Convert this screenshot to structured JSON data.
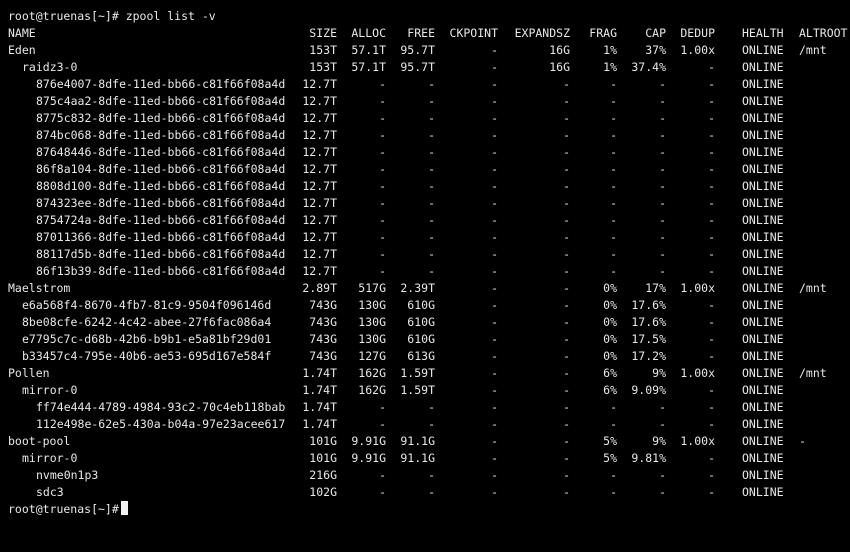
{
  "terminal": {
    "prompt_command": "root@truenas[~]# zpool list -v",
    "prompt_end": "root@truenas[~]#"
  },
  "headers": [
    "NAME",
    "SIZE",
    "ALLOC",
    "FREE",
    "CKPOINT",
    "EXPANDSZ",
    "FRAG",
    "CAP",
    "DEDUP",
    "HEALTH",
    "ALTROOT"
  ],
  "rows": [
    {
      "indent": 0,
      "cells": [
        "Eden",
        "153T",
        "57.1T",
        "95.7T",
        "-",
        "16G",
        "1%",
        "37%",
        "1.00x",
        "ONLINE",
        "/mnt"
      ]
    },
    {
      "indent": 1,
      "cells": [
        "raidz3-0",
        "153T",
        "57.1T",
        "95.7T",
        "-",
        "16G",
        "1%",
        "37.4%",
        "-",
        "ONLINE",
        ""
      ]
    },
    {
      "indent": 2,
      "cells": [
        "876e4007-8dfe-11ed-bb66-c81f66f08a4d",
        "12.7T",
        "-",
        "-",
        "-",
        "-",
        "-",
        "-",
        "-",
        "ONLINE",
        ""
      ]
    },
    {
      "indent": 2,
      "cells": [
        "875c4aa2-8dfe-11ed-bb66-c81f66f08a4d",
        "12.7T",
        "-",
        "-",
        "-",
        "-",
        "-",
        "-",
        "-",
        "ONLINE",
        ""
      ]
    },
    {
      "indent": 2,
      "cells": [
        "8775c832-8dfe-11ed-bb66-c81f66f08a4d",
        "12.7T",
        "-",
        "-",
        "-",
        "-",
        "-",
        "-",
        "-",
        "ONLINE",
        ""
      ]
    },
    {
      "indent": 2,
      "cells": [
        "874bc068-8dfe-11ed-bb66-c81f66f08a4d",
        "12.7T",
        "-",
        "-",
        "-",
        "-",
        "-",
        "-",
        "-",
        "ONLINE",
        ""
      ]
    },
    {
      "indent": 2,
      "cells": [
        "87648446-8dfe-11ed-bb66-c81f66f08a4d",
        "12.7T",
        "-",
        "-",
        "-",
        "-",
        "-",
        "-",
        "-",
        "ONLINE",
        ""
      ]
    },
    {
      "indent": 2,
      "cells": [
        "86f8a104-8dfe-11ed-bb66-c81f66f08a4d",
        "12.7T",
        "-",
        "-",
        "-",
        "-",
        "-",
        "-",
        "-",
        "ONLINE",
        ""
      ]
    },
    {
      "indent": 2,
      "cells": [
        "8808d100-8dfe-11ed-bb66-c81f66f08a4d",
        "12.7T",
        "-",
        "-",
        "-",
        "-",
        "-",
        "-",
        "-",
        "ONLINE",
        ""
      ]
    },
    {
      "indent": 2,
      "cells": [
        "874323ee-8dfe-11ed-bb66-c81f66f08a4d",
        "12.7T",
        "-",
        "-",
        "-",
        "-",
        "-",
        "-",
        "-",
        "ONLINE",
        ""
      ]
    },
    {
      "indent": 2,
      "cells": [
        "8754724a-8dfe-11ed-bb66-c81f66f08a4d",
        "12.7T",
        "-",
        "-",
        "-",
        "-",
        "-",
        "-",
        "-",
        "ONLINE",
        ""
      ]
    },
    {
      "indent": 2,
      "cells": [
        "87011366-8dfe-11ed-bb66-c81f66f08a4d",
        "12.7T",
        "-",
        "-",
        "-",
        "-",
        "-",
        "-",
        "-",
        "ONLINE",
        ""
      ]
    },
    {
      "indent": 2,
      "cells": [
        "88117d5b-8dfe-11ed-bb66-c81f66f08a4d",
        "12.7T",
        "-",
        "-",
        "-",
        "-",
        "-",
        "-",
        "-",
        "ONLINE",
        ""
      ]
    },
    {
      "indent": 2,
      "cells": [
        "86f13b39-8dfe-11ed-bb66-c81f66f08a4d",
        "12.7T",
        "-",
        "-",
        "-",
        "-",
        "-",
        "-",
        "-",
        "ONLINE",
        ""
      ]
    },
    {
      "indent": 0,
      "cells": [
        "Maelstrom",
        "2.89T",
        "517G",
        "2.39T",
        "-",
        "-",
        "0%",
        "17%",
        "1.00x",
        "ONLINE",
        "/mnt"
      ]
    },
    {
      "indent": 1,
      "cells": [
        "e6a568f4-8670-4fb7-81c9-9504f096146d",
        "743G",
        "130G",
        "610G",
        "-",
        "-",
        "0%",
        "17.6%",
        "-",
        "ONLINE",
        ""
      ]
    },
    {
      "indent": 1,
      "cells": [
        "8be08cfe-6242-4c42-abee-27f6fac086a4",
        "743G",
        "130G",
        "610G",
        "-",
        "-",
        "0%",
        "17.6%",
        "-",
        "ONLINE",
        ""
      ]
    },
    {
      "indent": 1,
      "cells": [
        "e7795c7c-d68b-42b6-b9b1-e5a81bf29d01",
        "743G",
        "130G",
        "610G",
        "-",
        "-",
        "0%",
        "17.5%",
        "-",
        "ONLINE",
        ""
      ]
    },
    {
      "indent": 1,
      "cells": [
        "b33457c4-795e-40b6-ae53-695d167e584f",
        "743G",
        "127G",
        "613G",
        "-",
        "-",
        "0%",
        "17.2%",
        "-",
        "ONLINE",
        ""
      ]
    },
    {
      "indent": 0,
      "cells": [
        "Pollen",
        "1.74T",
        "162G",
        "1.59T",
        "-",
        "-",
        "6%",
        "9%",
        "1.00x",
        "ONLINE",
        "/mnt"
      ]
    },
    {
      "indent": 1,
      "cells": [
        "mirror-0",
        "1.74T",
        "162G",
        "1.59T",
        "-",
        "-",
        "6%",
        "9.09%",
        "-",
        "ONLINE",
        ""
      ]
    },
    {
      "indent": 2,
      "cells": [
        "ff74e444-4789-4984-93c2-70c4eb118bab",
        "1.74T",
        "-",
        "-",
        "-",
        "-",
        "-",
        "-",
        "-",
        "ONLINE",
        ""
      ]
    },
    {
      "indent": 2,
      "cells": [
        "112e498e-62e5-430a-b04a-97e23acee617",
        "1.74T",
        "-",
        "-",
        "-",
        "-",
        "-",
        "-",
        "-",
        "ONLINE",
        ""
      ]
    },
    {
      "indent": 0,
      "cells": [
        "boot-pool",
        "101G",
        "9.91G",
        "91.1G",
        "-",
        "-",
        "5%",
        "9%",
        "1.00x",
        "ONLINE",
        "-"
      ]
    },
    {
      "indent": 1,
      "cells": [
        "mirror-0",
        "101G",
        "9.91G",
        "91.1G",
        "-",
        "-",
        "5%",
        "9.81%",
        "-",
        "ONLINE",
        ""
      ]
    },
    {
      "indent": 2,
      "cells": [
        "nvme0n1p3",
        "216G",
        "-",
        "-",
        "-",
        "-",
        "-",
        "-",
        "-",
        "ONLINE",
        ""
      ]
    },
    {
      "indent": 2,
      "cells": [
        "sdc3",
        "102G",
        "-",
        "-",
        "-",
        "-",
        "-",
        "-",
        "-",
        "ONLINE",
        ""
      ]
    }
  ]
}
